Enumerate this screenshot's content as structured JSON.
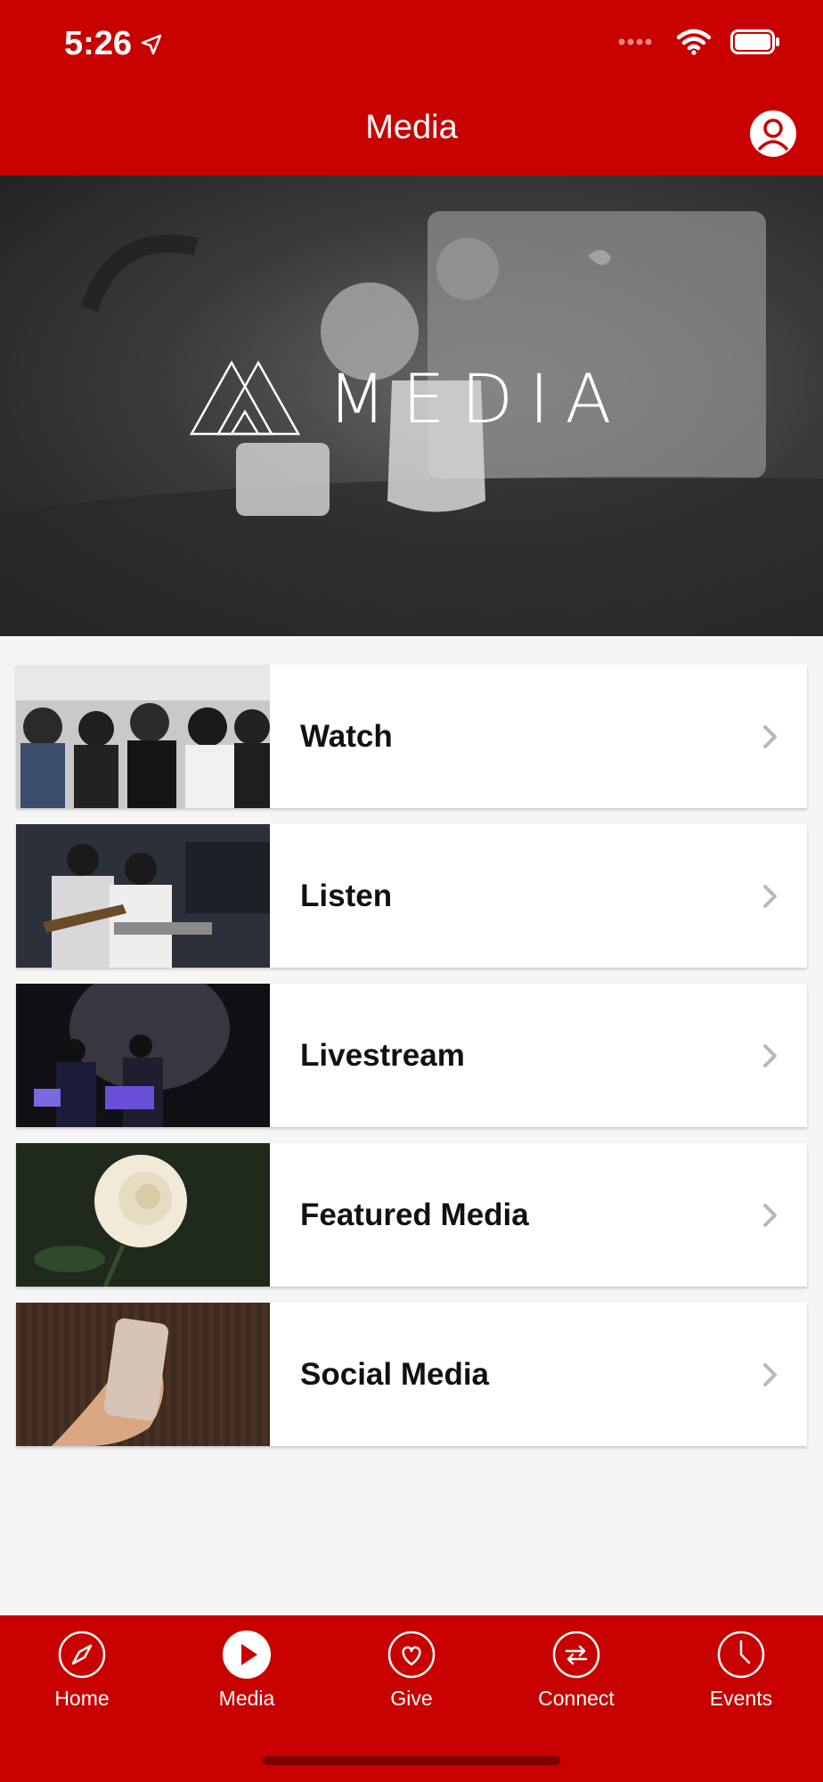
{
  "status_bar": {
    "time": "5:26"
  },
  "nav": {
    "title": "Media"
  },
  "hero": {
    "text": "MEDIA"
  },
  "list": [
    {
      "label": "Watch",
      "thumb": "worship-crowd"
    },
    {
      "label": "Listen",
      "thumb": "band-performing"
    },
    {
      "label": "Livestream",
      "thumb": "stage-lights"
    },
    {
      "label": "Featured Media",
      "thumb": "white-rose"
    },
    {
      "label": "Social Media",
      "thumb": "phone-in-hand"
    }
  ],
  "tabs": [
    {
      "label": "Home",
      "icon": "compass-icon"
    },
    {
      "label": "Media",
      "icon": "play-icon"
    },
    {
      "label": "Give",
      "icon": "heart-icon"
    },
    {
      "label": "Connect",
      "icon": "arrows-icon"
    },
    {
      "label": "Events",
      "icon": "clock-icon"
    }
  ],
  "colors": {
    "brand": "#c80000",
    "background": "#f5f5f5"
  }
}
